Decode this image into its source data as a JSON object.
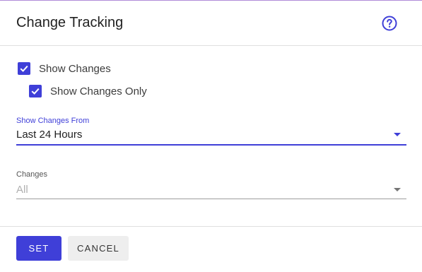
{
  "dialog": {
    "title": "Change Tracking",
    "help_icon": "help-circle-icon"
  },
  "options": {
    "show_changes": {
      "label": "Show Changes",
      "checked": true
    },
    "show_changes_only": {
      "label": "Show Changes Only",
      "checked": true
    }
  },
  "show_changes_from": {
    "label": "Show Changes From",
    "value": "Last 24 Hours"
  },
  "changes": {
    "label": "Changes",
    "value": "All"
  },
  "footer": {
    "set_label": "SET",
    "cancel_label": "CANCEL"
  },
  "colors": {
    "accent": "#3f3fd8",
    "top_border": "#b08bd8",
    "cancel_bg": "#eeeeee"
  }
}
